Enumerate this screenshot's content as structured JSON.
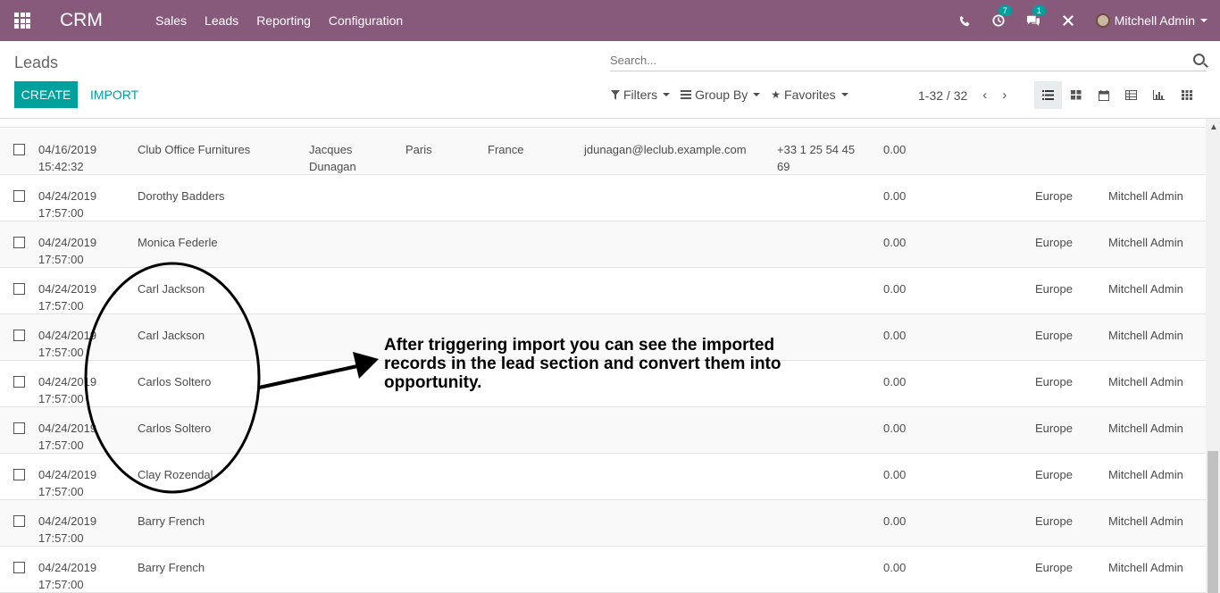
{
  "header": {
    "app_name": "CRM",
    "menu": [
      "Sales",
      "Leads",
      "Reporting",
      "Configuration"
    ],
    "activity_badge": "7",
    "messages_badge": "1",
    "user_name": "Mitchell Admin"
  },
  "control": {
    "breadcrumb": "Leads",
    "create_label": "CREATE",
    "import_label": "IMPORT",
    "search_placeholder": "Search...",
    "filters_label": "Filters",
    "groupby_label": "Group By",
    "favorites_label": "Favorites",
    "pager": "1-32 / 32"
  },
  "rows": [
    {
      "date": "04/16/2019",
      "time": "15:42:32",
      "name": "Club Office Furnitures",
      "contact1": "Jacques",
      "contact2": "Dunagan",
      "city": "Paris",
      "country": "France",
      "email": "jdunagan@leclub.example.com",
      "phone1": "+33 1 25 54 45",
      "phone2": "69",
      "revenue": "0.00",
      "team": "",
      "salesperson": ""
    },
    {
      "date": "04/24/2019",
      "time": "17:57:00",
      "name": "Dorothy Badders",
      "contact1": "",
      "contact2": "",
      "city": "",
      "country": "",
      "email": "",
      "phone1": "",
      "phone2": "",
      "revenue": "0.00",
      "team": "Europe",
      "salesperson": "Mitchell Admin"
    },
    {
      "date": "04/24/2019",
      "time": "17:57:00",
      "name": "Monica Federle",
      "contact1": "",
      "contact2": "",
      "city": "",
      "country": "",
      "email": "",
      "phone1": "",
      "phone2": "",
      "revenue": "0.00",
      "team": "Europe",
      "salesperson": "Mitchell Admin"
    },
    {
      "date": "04/24/2019",
      "time": "17:57:00",
      "name": "Carl Jackson",
      "contact1": "",
      "contact2": "",
      "city": "",
      "country": "",
      "email": "",
      "phone1": "",
      "phone2": "",
      "revenue": "0.00",
      "team": "Europe",
      "salesperson": "Mitchell Admin"
    },
    {
      "date": "04/24/2019",
      "time": "17:57:00",
      "name": "Carl Jackson",
      "contact1": "",
      "contact2": "",
      "city": "",
      "country": "",
      "email": "",
      "phone1": "",
      "phone2": "",
      "revenue": "0.00",
      "team": "Europe",
      "salesperson": "Mitchell Admin"
    },
    {
      "date": "04/24/2019",
      "time": "17:57:00",
      "name": "Carlos Soltero",
      "contact1": "",
      "contact2": "",
      "city": "",
      "country": "",
      "email": "",
      "phone1": "",
      "phone2": "",
      "revenue": "0.00",
      "team": "Europe",
      "salesperson": "Mitchell Admin"
    },
    {
      "date": "04/24/2019",
      "time": "17:57:00",
      "name": "Carlos Soltero",
      "contact1": "",
      "contact2": "",
      "city": "",
      "country": "",
      "email": "",
      "phone1": "",
      "phone2": "",
      "revenue": "0.00",
      "team": "Europe",
      "salesperson": "Mitchell Admin"
    },
    {
      "date": "04/24/2019",
      "time": "17:57:00",
      "name": "Clay Rozendal",
      "contact1": "",
      "contact2": "",
      "city": "",
      "country": "",
      "email": "",
      "phone1": "",
      "phone2": "",
      "revenue": "0.00",
      "team": "Europe",
      "salesperson": "Mitchell Admin"
    },
    {
      "date": "04/24/2019",
      "time": "17:57:00",
      "name": "Barry French",
      "contact1": "",
      "contact2": "",
      "city": "",
      "country": "",
      "email": "",
      "phone1": "",
      "phone2": "",
      "revenue": "0.00",
      "team": "Europe",
      "salesperson": "Mitchell Admin"
    },
    {
      "date": "04/24/2019",
      "time": "17:57:00",
      "name": "Barry French",
      "contact1": "",
      "contact2": "",
      "city": "",
      "country": "",
      "email": "",
      "phone1": "",
      "phone2": "",
      "revenue": "0.00",
      "team": "Europe",
      "salesperson": "Mitchell Admin"
    }
  ],
  "annotation": {
    "line1": "After triggering import you can see the imported",
    "line2": "records in the lead section and convert them into",
    "line3": "opportunity."
  },
  "colors": {
    "brand": "#875a7b",
    "accent": "#00a09d"
  }
}
